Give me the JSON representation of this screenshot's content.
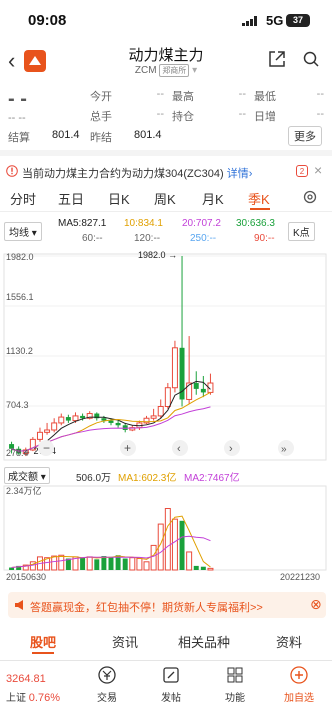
{
  "status": {
    "time": "09:08",
    "network": "5G",
    "battery": "37"
  },
  "header": {
    "title": "动力煤主力",
    "code": "ZCM",
    "exchange": "郑商所"
  },
  "quote": {
    "price": "- -",
    "change": "-- --",
    "fields": [
      {
        "label": "今开",
        "value": "--"
      },
      {
        "label": "最高",
        "value": "--"
      },
      {
        "label": "最低",
        "value": "--"
      },
      {
        "label": "总手",
        "value": "--"
      },
      {
        "label": "持仓",
        "value": "--"
      },
      {
        "label": "日增",
        "value": "--"
      }
    ],
    "settle_label": "结算",
    "settle_value": "801.4",
    "prev_settle_label": "昨结",
    "prev_settle_value": "801.4",
    "more_label": "更多"
  },
  "notice": {
    "text": "当前动力煤主力合约为动力煤304(ZC304)",
    "link": "详情",
    "badge": "2"
  },
  "tabs": [
    "分时",
    "五日",
    "日K",
    "周K",
    "月K",
    "季K"
  ],
  "ma": {
    "selector": "均线",
    "ma5": "MA5:827.1",
    "ma10": "10:834.1",
    "ma20": "20:707.2",
    "ma30": "30:636.3",
    "ma60": "60:--",
    "ma120": "120:--",
    "ma250": "250:--",
    "ma90": "90:--",
    "k_point": "K点"
  },
  "colors": {
    "up": "#e94b3c",
    "down": "#1aa13b",
    "ma5": "#222222",
    "ma10": "#e0a000",
    "ma20": "#c23fd8",
    "ma30": "#1aa13b",
    "ma250": "#59a6f0",
    "accent": "#e8531c"
  },
  "chart_data": {
    "type": "candlestick",
    "y_ticks": [
      "1982.0",
      "1556.1",
      "1130.2",
      "704.3",
      "278.4"
    ],
    "max_label": "1982.0",
    "min_label": "278.4",
    "x_start": "20150630",
    "x_end": "20221230",
    "candles": [
      {
        "o": 380,
        "c": 340,
        "h": 400,
        "l": 300
      },
      {
        "o": 340,
        "c": 300,
        "h": 360,
        "l": 290
      },
      {
        "o": 300,
        "c": 330,
        "h": 350,
        "l": 278
      },
      {
        "o": 330,
        "c": 420,
        "h": 440,
        "l": 320
      },
      {
        "o": 420,
        "c": 480,
        "h": 520,
        "l": 400
      },
      {
        "o": 480,
        "c": 500,
        "h": 560,
        "l": 460
      },
      {
        "o": 500,
        "c": 560,
        "h": 600,
        "l": 480
      },
      {
        "o": 560,
        "c": 610,
        "h": 640,
        "l": 540
      },
      {
        "o": 610,
        "c": 580,
        "h": 630,
        "l": 560
      },
      {
        "o": 580,
        "c": 620,
        "h": 650,
        "l": 560
      },
      {
        "o": 620,
        "c": 600,
        "h": 640,
        "l": 580
      },
      {
        "o": 600,
        "c": 640,
        "h": 660,
        "l": 590
      },
      {
        "o": 640,
        "c": 600,
        "h": 650,
        "l": 580
      },
      {
        "o": 600,
        "c": 580,
        "h": 620,
        "l": 560
      },
      {
        "o": 580,
        "c": 560,
        "h": 600,
        "l": 540
      },
      {
        "o": 560,
        "c": 540,
        "h": 580,
        "l": 520
      },
      {
        "o": 540,
        "c": 500,
        "h": 560,
        "l": 480
      },
      {
        "o": 500,
        "c": 520,
        "h": 540,
        "l": 490
      },
      {
        "o": 520,
        "c": 560,
        "h": 580,
        "l": 500
      },
      {
        "o": 560,
        "c": 600,
        "h": 620,
        "l": 550
      },
      {
        "o": 600,
        "c": 620,
        "h": 680,
        "l": 580
      },
      {
        "o": 620,
        "c": 700,
        "h": 760,
        "l": 600
      },
      {
        "o": 700,
        "c": 860,
        "h": 900,
        "l": 680
      },
      {
        "o": 860,
        "c": 1200,
        "h": 1260,
        "l": 820
      },
      {
        "o": 1200,
        "c": 760,
        "h": 1982,
        "l": 700
      },
      {
        "o": 760,
        "c": 900,
        "h": 1300,
        "l": 720
      },
      {
        "o": 900,
        "c": 850,
        "h": 1000,
        "l": 800
      },
      {
        "o": 850,
        "c": 820,
        "h": 960,
        "l": 780
      },
      {
        "o": 820,
        "c": 900,
        "h": 980,
        "l": 800
      }
    ],
    "volume_header": {
      "label": "成交额",
      "value": "506.0万",
      "ma1": "MA1:602.3亿",
      "ma2": "MA2:7467亿",
      "max_label": "2.34万亿"
    },
    "volumes": [
      0.03,
      0.05,
      0.06,
      0.1,
      0.16,
      0.15,
      0.17,
      0.18,
      0.14,
      0.16,
      0.15,
      0.16,
      0.13,
      0.17,
      0.16,
      0.18,
      0.14,
      0.15,
      0.14,
      0.1,
      0.3,
      0.56,
      0.75,
      0.62,
      0.6,
      0.22,
      0.05,
      0.04,
      0.02
    ]
  },
  "banner": {
    "text": "答题赢现金，红包抽不停！期货新人专属福利>>"
  },
  "bottom_tabs": [
    "股吧",
    "资讯",
    "相关品种",
    "资料"
  ],
  "nav": {
    "index_name": "上证",
    "index_value": "3264.81",
    "index_pct": "0.76%",
    "items": [
      "交易",
      "发帖",
      "功能",
      "加自选"
    ]
  }
}
